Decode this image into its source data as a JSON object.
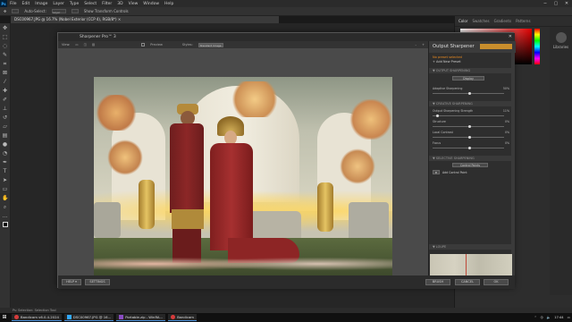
{
  "photoshop": {
    "logo": "Ps",
    "menu": [
      "File",
      "Edit",
      "Image",
      "Layer",
      "Type",
      "Select",
      "Filter",
      "3D",
      "View",
      "Window",
      "Help"
    ],
    "window_controls": [
      "─",
      "▢",
      "✕"
    ],
    "options": {
      "auto_select": "Auto-Select:",
      "layer": "Layer",
      "show_transform": "Show Transform Controls"
    },
    "doc_tab": "DSC00967.JPG @ 16.7% (Nobel Exterior (CCP 4), RGB/8*) ×",
    "panel_tabs": [
      "Color",
      "Swatches",
      "Gradients",
      "Patterns"
    ],
    "libraries_label": "Libraries",
    "status_text": "Ps: Selection: Selection Tool"
  },
  "dialog": {
    "title": "Sharpener Pro™ 3",
    "tools": {
      "view": "View:",
      "preview": "Preview",
      "styles": "Styles:",
      "styles_value": "Standard Image"
    },
    "preview_caption": "DSC00967.JPG\n66.83 × 15.01 cm, 72 ppcm",
    "panel_title": "Output Sharpener",
    "preset_selected": "No preset selected",
    "add_preset": "+ Add New Preset",
    "section_output": "▼ OUTPUT SHARPENING",
    "display_label": "Display",
    "adaptive_label": "Adaptive Sharpening",
    "adaptive_val": "50%",
    "section_creative": "▼ CREATIVE SHARPENING",
    "creative_rows": [
      {
        "label": "Output Sharpening Strength",
        "val": "11%"
      },
      {
        "label": "Structure",
        "val": "0%"
      },
      {
        "label": "Local Contrast",
        "val": "0%"
      },
      {
        "label": "Focus",
        "val": "0%"
      }
    ],
    "section_selective": "▼ SELECTIVE SHARPENING",
    "control_points": "Control Points",
    "add_control": "Add Control Point",
    "loupe_label": "▼ LOUPE",
    "buttons": {
      "help": "HELP ▾",
      "settings": "SETTINGS",
      "brush": "BRUSH",
      "cancel": "CANCEL",
      "ok": "OK"
    }
  },
  "taskbar": {
    "items": [
      {
        "label": "Bandicam v6.0.4.2024"
      },
      {
        "label": "DSC00967.JPG @ 16..."
      },
      {
        "label": "Portable.zip - WinRA..."
      },
      {
        "label": "Bandicam"
      }
    ],
    "time": "17:44"
  },
  "colors": {
    "accent_orange": "#e88a20",
    "taskbar_highlight": "#4a8fd8"
  }
}
